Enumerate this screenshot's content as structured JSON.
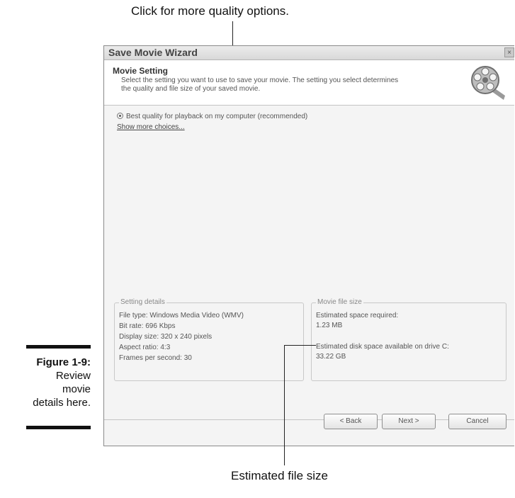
{
  "callouts": {
    "top": "Click for more quality options.",
    "bottom": "Estimated file size"
  },
  "figure": {
    "number": "Figure 1-9:",
    "caption_lines": [
      "Review",
      "movie",
      "details here."
    ]
  },
  "window": {
    "title": "Save Movie Wizard",
    "close_glyph": "×",
    "header": {
      "title": "Movie Setting",
      "description": "Select the setting you want to use to save your movie. The setting you select determines the quality and file size of your saved movie."
    },
    "quality_option": "Best quality for playback on my computer (recommended)",
    "show_more_link": "Show more choices...",
    "setting_details": {
      "legend": "Setting details",
      "lines": [
        "File type: Windows Media Video (WMV)",
        "Bit rate: 696 Kbps",
        "Display size: 320 x 240 pixels",
        "Aspect ratio: 4:3",
        "Frames per second: 30"
      ]
    },
    "movie_file_size": {
      "legend": "Movie file size",
      "estimated_label": "Estimated space required:",
      "estimated_value": "1.23 MB",
      "disk_label": "Estimated disk space available on drive C:",
      "disk_value": "33.22 GB"
    },
    "buttons": {
      "back": "< Back",
      "next": "Next >",
      "cancel": "Cancel"
    }
  }
}
